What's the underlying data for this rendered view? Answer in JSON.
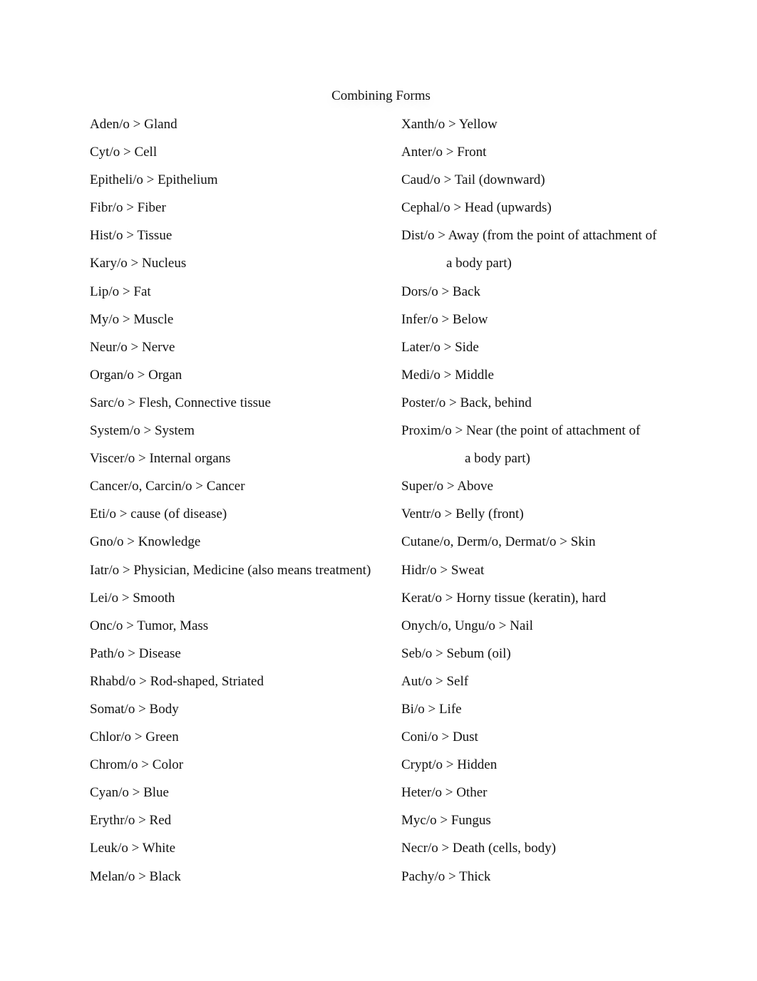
{
  "document": {
    "title": "Combining Forms",
    "left_column": [
      "Aden/o > Gland",
      "Cyt/o > Cell",
      "Epitheli/o > Epithelium",
      "Fibr/o > Fiber",
      "Hist/o > Tissue",
      "Kary/o > Nucleus",
      "Lip/o > Fat",
      "My/o > Muscle",
      "Neur/o > Nerve",
      "Organ/o > Organ",
      "Sarc/o > Flesh, Connective tissue",
      "System/o > System",
      "Viscer/o > Internal organs",
      "Cancer/o, Carcin/o > Cancer",
      "Eti/o > cause (of disease)",
      "Gno/o > Knowledge",
      "Iatr/o > Physician, Medicine (also means treatment)",
      "Lei/o > Smooth",
      "Onc/o > Tumor, Mass",
      "Path/o > Disease",
      "Rhabd/o > Rod-shaped, Striated",
      "Somat/o > Body",
      "Chlor/o > Green",
      "Chrom/o > Color",
      "Cyan/o > Blue",
      "Erythr/o > Red",
      "Leuk/o > White",
      "Melan/o > Black"
    ],
    "right_column": [
      "Xanth/o > Yellow",
      "Anter/o > Front",
      "Caud/o > Tail (downward)",
      "Cephal/o > Head (upwards)",
      "Dist/o > Away (from the point of attachment of",
      "a body part)",
      "Dors/o > Back",
      "Infer/o > Below",
      "Later/o > Side",
      "Medi/o > Middle",
      "Poster/o > Back, behind",
      "Proxim/o > Near (the point of attachment of",
      "a body part)",
      "Super/o > Above",
      "Ventr/o > Belly (front)",
      "Cutane/o, Derm/o, Dermat/o > Skin",
      "Hidr/o > Sweat",
      "Kerat/o > Horny tissue (keratin), hard",
      "Onych/o, Ungu/o > Nail",
      "Seb/o > Sebum (oil)",
      "Aut/o > Self",
      "Bi/o > Life",
      "Coni/o > Dust",
      "Crypt/o > Hidden",
      "Heter/o > Other",
      "Myc/o > Fungus",
      "Necr/o > Death (cells, body)",
      "Pachy/o > Thick"
    ]
  }
}
